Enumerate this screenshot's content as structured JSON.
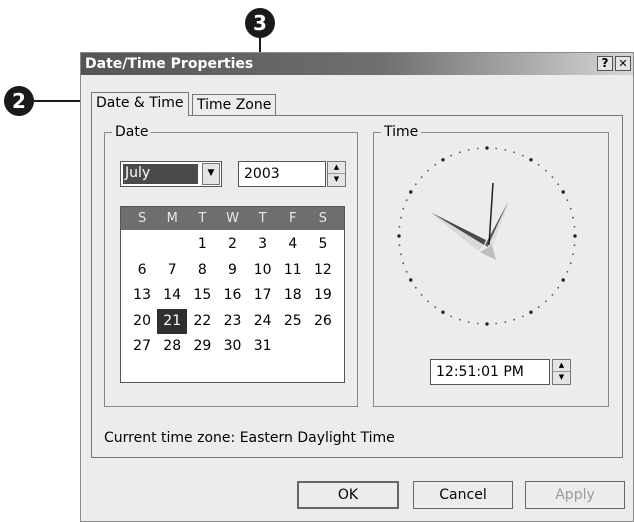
{
  "callouts": {
    "two": "2",
    "three": "3"
  },
  "window": {
    "title": "Date/Time Properties",
    "help_label": "?",
    "close_label": "✕"
  },
  "tabs": [
    {
      "label": "Date & Time",
      "active": true
    },
    {
      "label": "Time Zone",
      "active": false
    }
  ],
  "date_group": {
    "label": "Date",
    "month": "July",
    "year": "2003",
    "weekdays": [
      "S",
      "M",
      "T",
      "W",
      "T",
      "F",
      "S"
    ],
    "days": [
      "",
      "",
      "1",
      "2",
      "3",
      "4",
      "5",
      "6",
      "7",
      "8",
      "9",
      "10",
      "11",
      "12",
      "13",
      "14",
      "15",
      "16",
      "17",
      "18",
      "19",
      "20",
      "21",
      "22",
      "23",
      "24",
      "25",
      "26",
      "27",
      "28",
      "29",
      "30",
      "31",
      "",
      ""
    ],
    "selected_day": "21"
  },
  "time_group": {
    "label": "Time",
    "time_value": "12:51:01 PM"
  },
  "timezone": {
    "label": "Current time zone:",
    "value": "Eastern Daylight Time"
  },
  "buttons": {
    "ok": "OK",
    "cancel": "Cancel",
    "apply": "Apply"
  },
  "colors": {
    "titlebar_start": "#555555",
    "selection": "#4a4a4a"
  },
  "icons": {
    "dropdown": "chevron-down-icon",
    "spin_up": "arrow-up-icon",
    "spin_down": "arrow-down-icon"
  }
}
